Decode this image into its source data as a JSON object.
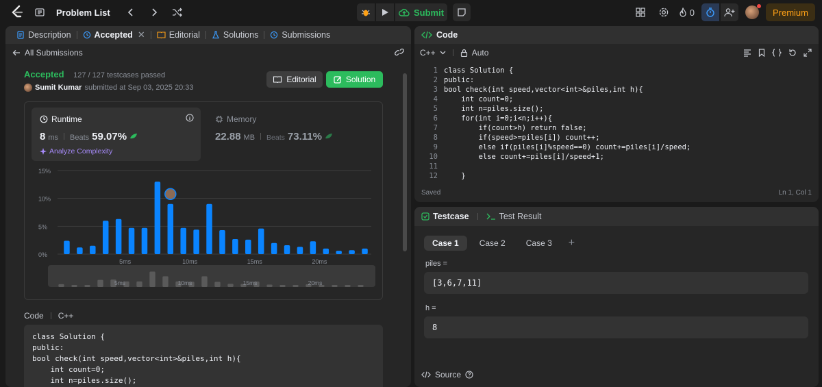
{
  "topbar": {
    "problem_list": "Problem List",
    "submit_label": "Submit",
    "streak_count": "0",
    "premium_label": "Premium"
  },
  "left_tabs": [
    {
      "label": "Description"
    },
    {
      "label": "Accepted"
    },
    {
      "label": "Editorial"
    },
    {
      "label": "Solutions"
    },
    {
      "label": "Submissions"
    }
  ],
  "submission": {
    "back_label": "All Submissions",
    "status": "Accepted",
    "testcases": "127 / 127 testcases passed",
    "user": "Sumit Kumar",
    "submitted_at": "submitted at Sep 03, 2025 20:33",
    "editorial_btn": "Editorial",
    "solution_btn": "Solution"
  },
  "runtime": {
    "label": "Runtime",
    "value": "8",
    "unit": "ms",
    "beats_label": "Beats",
    "beats_value": "59.07%",
    "analyze": "Analyze Complexity"
  },
  "memory": {
    "label": "Memory",
    "value": "22.88",
    "unit": "MB",
    "beats_label": "Beats",
    "beats_value": "73.11%"
  },
  "chart_data": {
    "type": "bar",
    "y_ticks": [
      "15%",
      "10%",
      "5%",
      "0%"
    ],
    "x_ticks": [
      "5ms",
      "10ms",
      "15ms",
      "20ms"
    ],
    "ylim": [
      0,
      15
    ],
    "values": [
      2.4,
      1.2,
      1.5,
      6.0,
      6.3,
      4.7,
      4.7,
      13.0,
      9.0,
      4.7,
      4.4,
      9.0,
      4.3,
      2.7,
      2.6,
      4.6,
      2.0,
      1.6,
      1.3,
      2.3,
      1.0,
      0.6,
      0.7,
      1.0
    ],
    "highlight_index": 7,
    "color": "#0a84ff"
  },
  "code_section": {
    "label": "Code",
    "lang": "C++",
    "lines": [
      "class Solution {",
      "public:",
      "bool check(int speed,vector<int>&piles,int h){",
      "    int count=0;",
      "    int n=piles.size();"
    ]
  },
  "editor": {
    "title": "Code",
    "lang": "C++",
    "mode": "Auto",
    "line_numbers": [
      "1",
      "2",
      "3",
      "4",
      "5",
      "6",
      "7",
      "8",
      "9",
      "10",
      "11",
      "12"
    ],
    "lines": [
      "class Solution {",
      "public:",
      "bool check(int speed,vector<int>&piles,int h){",
      "    int count=0;",
      "    int n=piles.size();",
      "    for(int i=0;i<n;i++){",
      "        if(count>h) return false;",
      "        if(speed>=piles[i]) count++;",
      "        else if(piles[i]%speed==0) count+=piles[i]/speed;",
      "        else count+=piles[i]/speed+1;",
      "",
      "    }"
    ],
    "saved": "Saved",
    "cursor": "Ln 1, Col 1"
  },
  "testcase": {
    "tab_testcase": "Testcase",
    "tab_result": "Test Result",
    "cases": [
      "Case 1",
      "Case 2",
      "Case 3"
    ],
    "vars": [
      {
        "name": "piles =",
        "value": "[3,6,7,11]"
      },
      {
        "name": "h =",
        "value": "8"
      }
    ],
    "source": "Source"
  }
}
